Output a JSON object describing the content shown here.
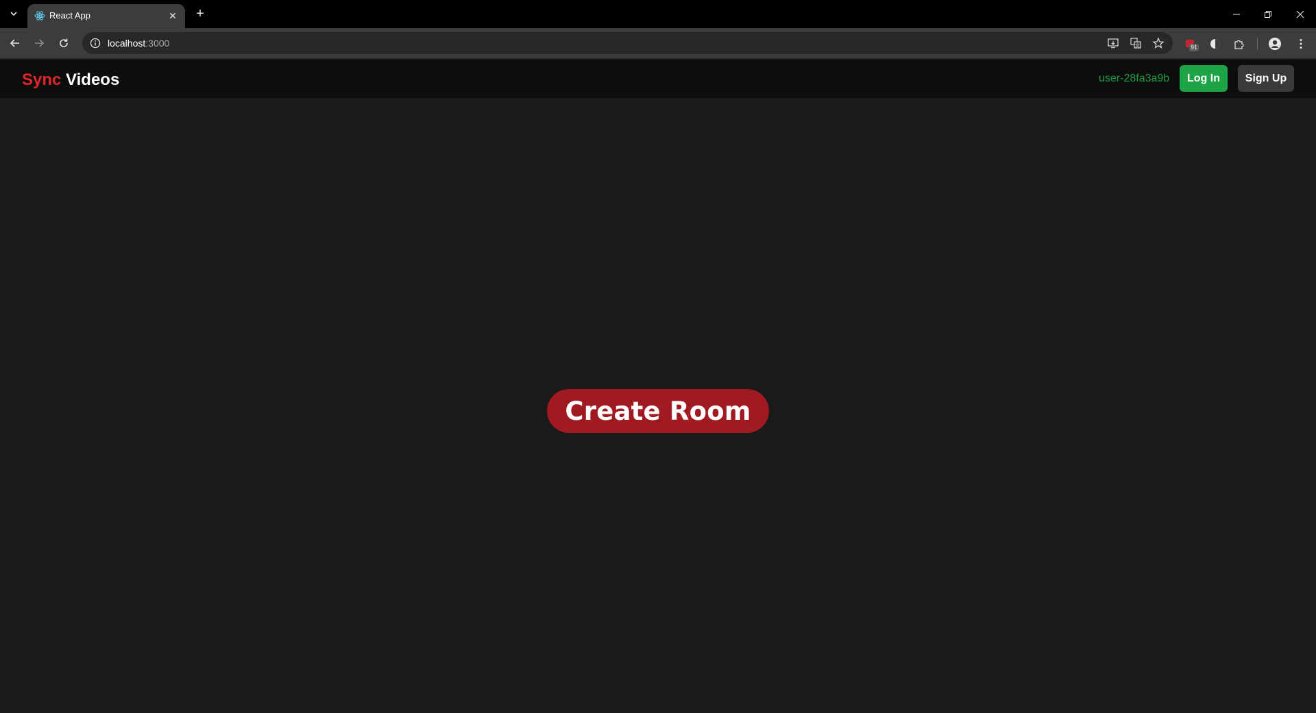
{
  "browser": {
    "tab": {
      "title": "React App"
    },
    "url": {
      "host": "localhost",
      "port": ":3000"
    },
    "extension_badge": "91"
  },
  "app": {
    "logo": {
      "part1": "Sync",
      "part2": " Videos"
    },
    "header": {
      "username": "user-28fa3a9b",
      "login_label": "Log In",
      "signup_label": "Sign Up"
    },
    "main": {
      "create_room_label": "Create Room"
    }
  },
  "colors": {
    "accent_red": "#e0262b",
    "create_room_bg": "#a01b21",
    "login_green": "#1ea446",
    "username_green": "#1f9d45",
    "background": "#1a1a1a"
  }
}
